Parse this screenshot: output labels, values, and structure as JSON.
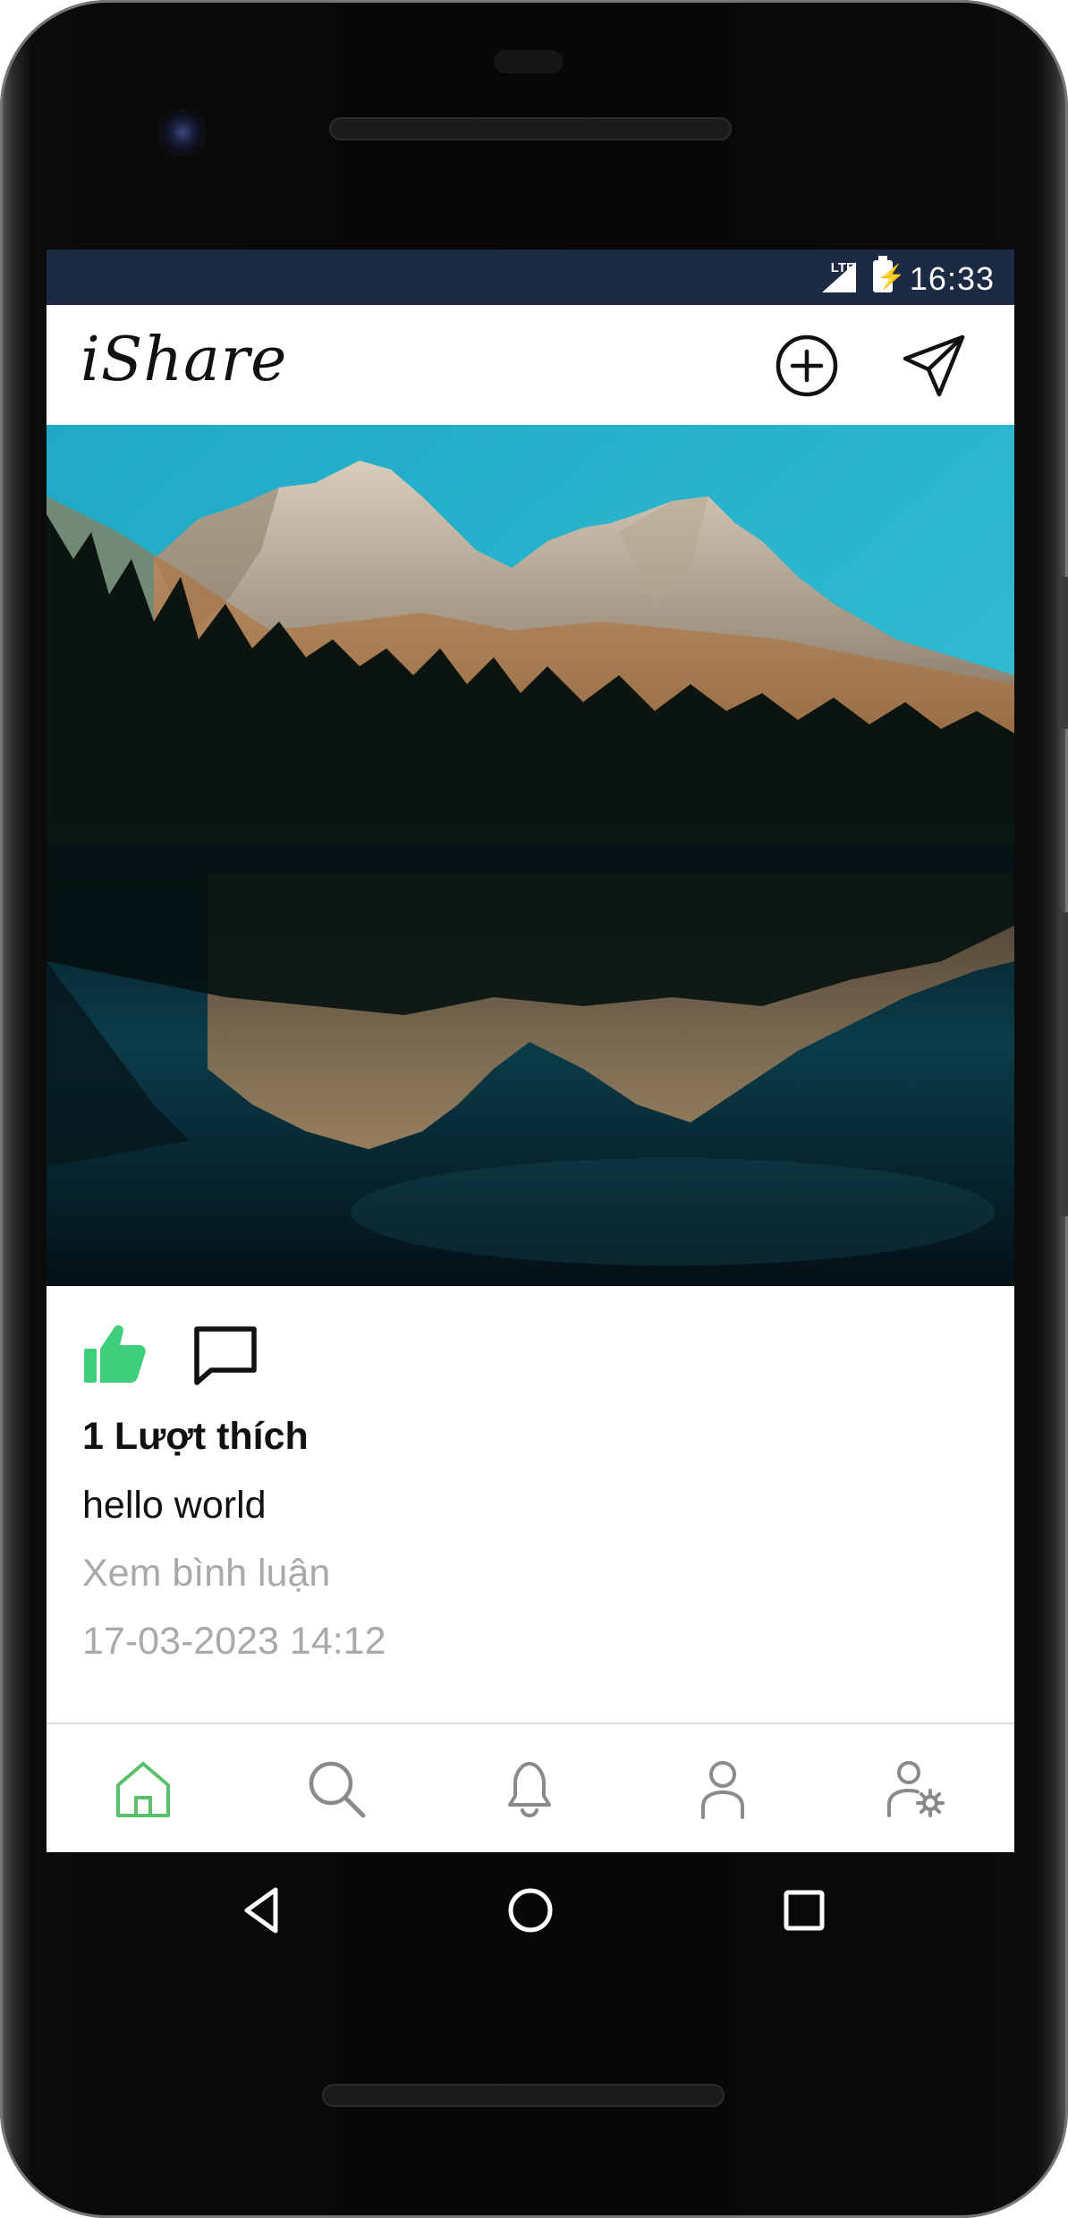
{
  "status_bar": {
    "network": "LTE",
    "time": "16:33"
  },
  "app_bar": {
    "logo": "iShare",
    "actions": [
      "add-circle-icon",
      "send-icon"
    ]
  },
  "post": {
    "image": "mountain-lake-reflection",
    "liked": true,
    "likes_text": "1 Lượt thích",
    "caption": "hello world",
    "view_comments": "Xem bình luận",
    "timestamp": "17-03-2023 14:12"
  },
  "bottom_nav": {
    "items": [
      {
        "icon": "home-icon",
        "active": true
      },
      {
        "icon": "search-icon",
        "active": false
      },
      {
        "icon": "bell-icon",
        "active": false
      },
      {
        "icon": "user-icon",
        "active": false
      },
      {
        "icon": "user-settings-icon",
        "active": false
      }
    ]
  },
  "colors": {
    "status_bar": "#1c2a44",
    "accent_green": "#3ecf7a",
    "nav_active": "#5cbf6c",
    "nav_inactive": "#8a8a8a",
    "muted_text": "#a9a9a9"
  }
}
